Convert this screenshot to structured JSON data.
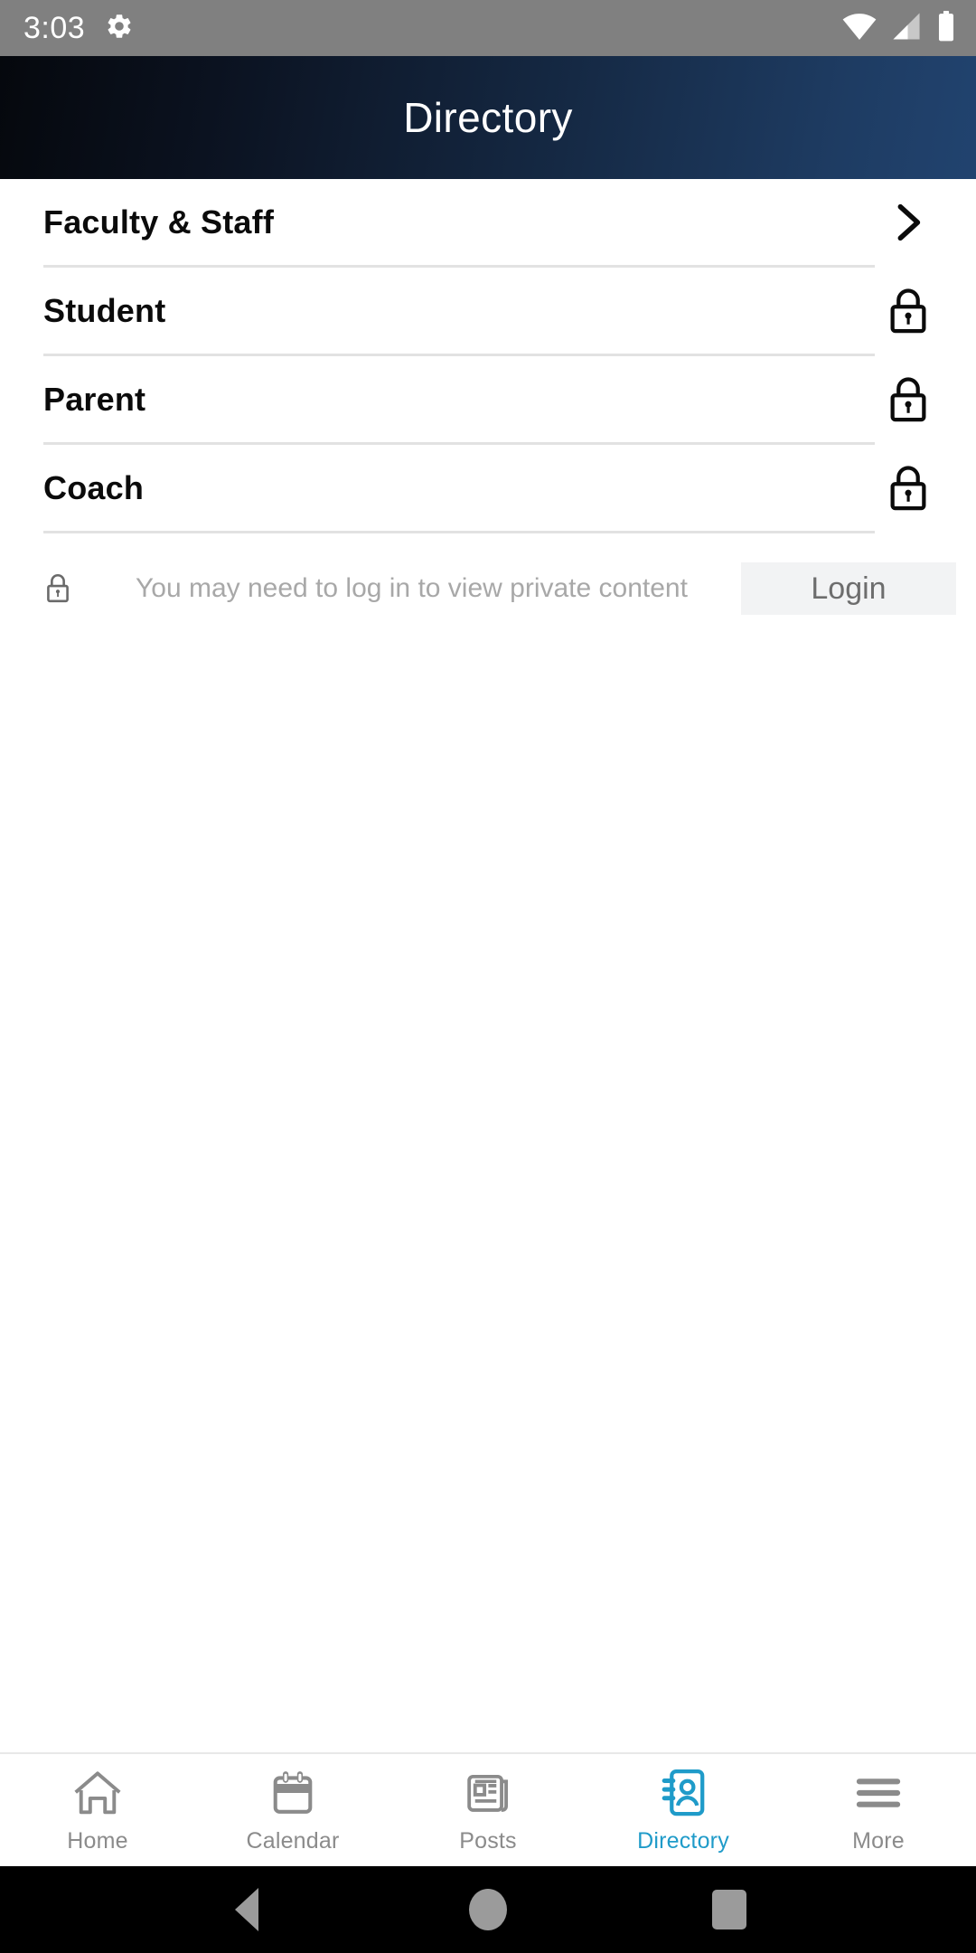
{
  "status_bar": {
    "time": "3:03",
    "icons": [
      "gear-icon",
      "wifi-icon",
      "cellular-signal-icon",
      "battery-icon"
    ]
  },
  "header": {
    "title": "Directory",
    "gradient_from": "#05080d",
    "gradient_to": "#21436f"
  },
  "directory": {
    "rows": [
      {
        "label": "Faculty & Staff",
        "trailing": "chevron-right-icon",
        "locked": false
      },
      {
        "label": "Student",
        "trailing": "lock-icon",
        "locked": true
      },
      {
        "label": "Parent",
        "trailing": "lock-icon",
        "locked": true
      },
      {
        "label": "Coach",
        "trailing": "lock-icon",
        "locked": true
      }
    ]
  },
  "login_notice": {
    "lock_icon": "lock-icon",
    "message": "You may need to log in to view private content",
    "button_label": "Login",
    "button_bg": "#f2f3f4",
    "text_color": "#a8a8a8"
  },
  "tab_bar": {
    "active_color": "#1f9bc9",
    "inactive_color": "#8b8b8b",
    "tabs": [
      {
        "label": "Home",
        "icon": "home-icon",
        "active": false
      },
      {
        "label": "Calendar",
        "icon": "calendar-icon",
        "active": false
      },
      {
        "label": "Posts",
        "icon": "newspaper-icon",
        "active": false
      },
      {
        "label": "Directory",
        "icon": "contact-book-icon",
        "active": true
      },
      {
        "label": "More",
        "icon": "hamburger-menu-icon",
        "active": false
      }
    ]
  },
  "android_nav": {
    "buttons": [
      "back-triangle-icon",
      "home-circle-icon",
      "recents-square-icon"
    ]
  }
}
